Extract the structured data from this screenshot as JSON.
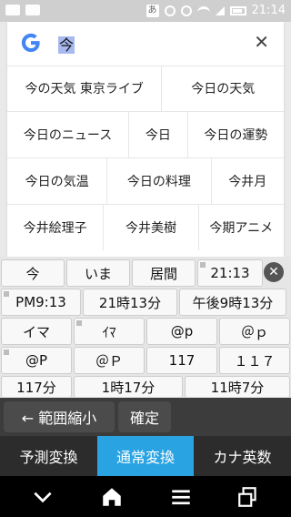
{
  "status": {
    "time": "21:14",
    "a_label": "あ"
  },
  "search": {
    "query": "今",
    "clear_icon": "close-icon",
    "logo": "google-g-icon",
    "colors": {
      "selection": "#a7b9ef"
    }
  },
  "suggestions": [
    [
      "今の天気 東京ライブ",
      "今日の天気"
    ],
    [
      "今日のニュース",
      "今日",
      "今日の運勢"
    ],
    [
      "今日の気温",
      "今日の料理",
      "今井月"
    ],
    [
      "今井絵理子",
      "今井美樹",
      "今期アニメ"
    ]
  ],
  "candidates": {
    "row1": [
      "今",
      "いま",
      "居間",
      "21:13"
    ],
    "row2": [
      "PM9:13",
      "21時13分",
      "午後9時13分"
    ],
    "row3": [
      "イマ",
      "ｲﾏ",
      "@p",
      "＠ｐ"
    ],
    "row4": [
      "@P",
      "＠Ｐ",
      "117",
      "１１７"
    ],
    "row5": [
      "117分",
      "1時17分",
      "11時7分"
    ]
  },
  "keyboard": {
    "narrow": "← 範囲縮小",
    "confirm": "確定",
    "modes": [
      "予測変換",
      "通常変換",
      "カナ英数"
    ],
    "active_mode": "通常変換",
    "colors": {
      "active": "#2aa3e3"
    }
  },
  "nav": {
    "icons": [
      "chevron-down-icon",
      "home-icon",
      "menu-icon",
      "recents-icon"
    ]
  }
}
